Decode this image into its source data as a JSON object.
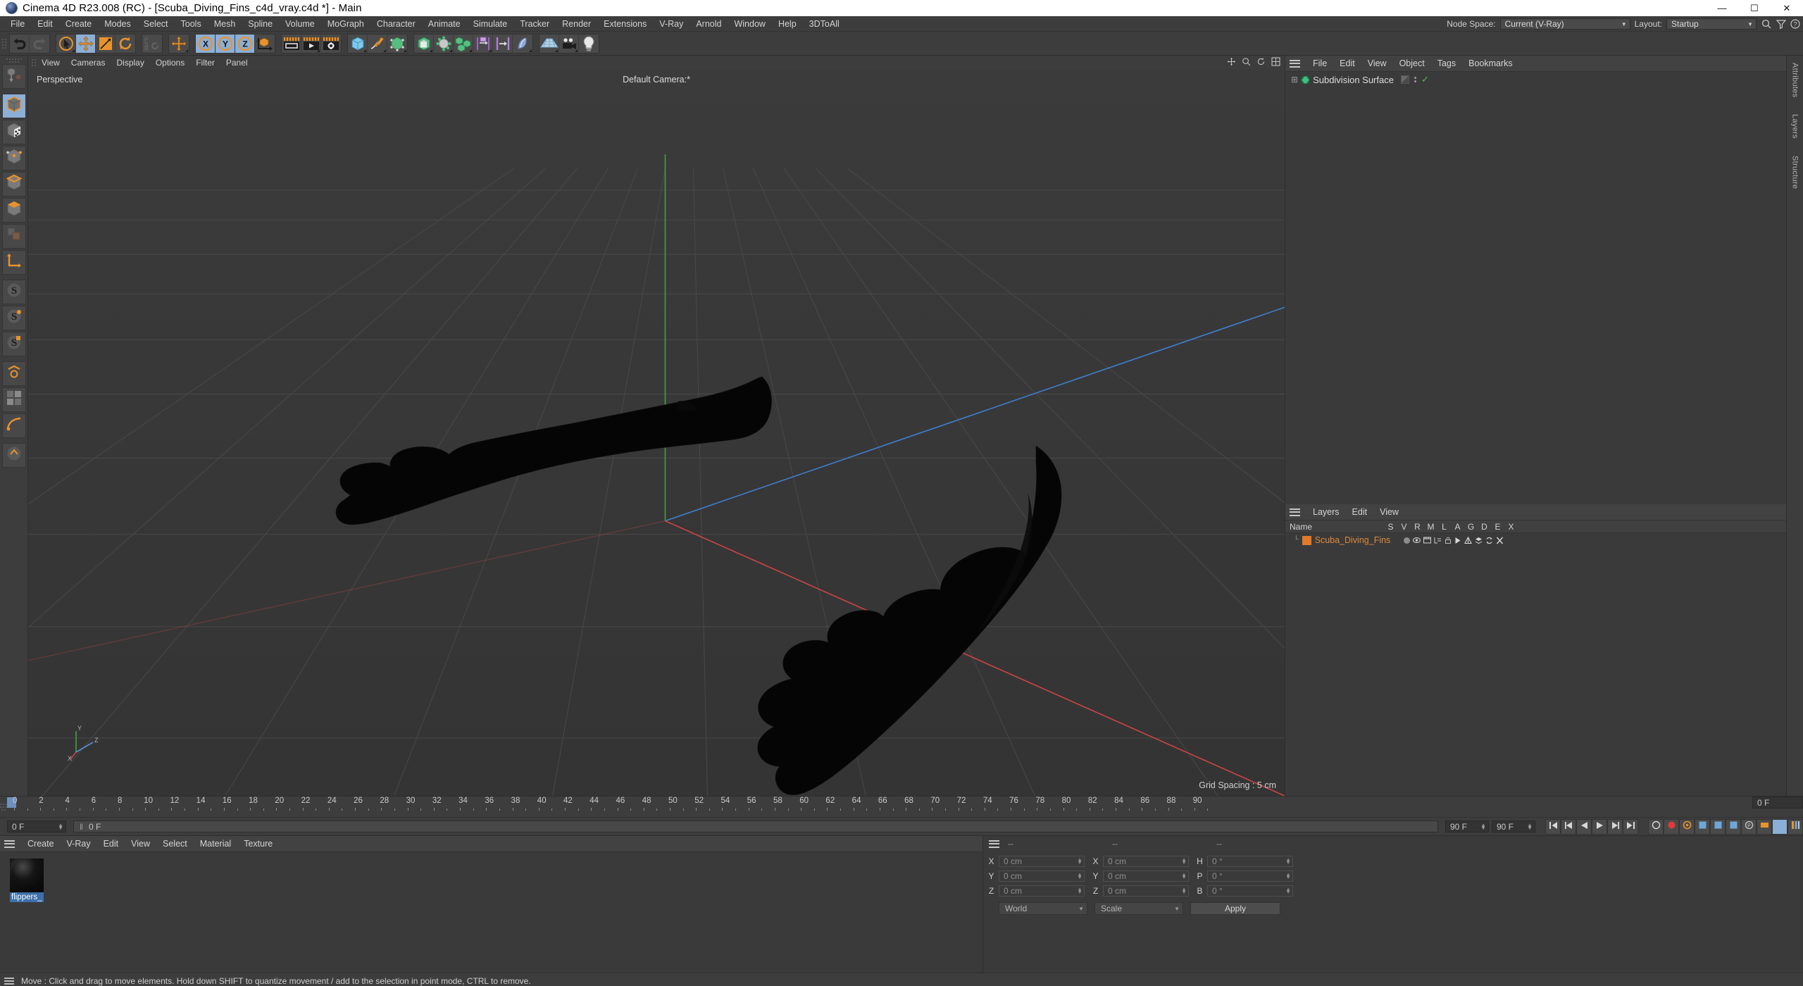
{
  "window": {
    "title": "Cinema 4D R23.008 (RC) - [Scuba_Diving_Fins_c4d_vray.c4d *] - Main",
    "minimize": "—",
    "maximize": "☐",
    "close": "✕"
  },
  "menubar": {
    "items": [
      "File",
      "Edit",
      "Create",
      "Modes",
      "Select",
      "Tools",
      "Mesh",
      "Spline",
      "Volume",
      "MoGraph",
      "Character",
      "Animate",
      "Simulate",
      "Tracker",
      "Render",
      "Extensions",
      "V-Ray",
      "Arnold",
      "Window",
      "Help",
      "3DToAll"
    ],
    "node_space_label": "Node Space:",
    "node_space_value": "Current (V-Ray)",
    "layout_label": "Layout:",
    "layout_value": "Startup"
  },
  "toolbar": {
    "groups": [
      {
        "name": "history",
        "buttons": [
          {
            "id": "undo-button",
            "icon": "undo-icon",
            "active": false,
            "corner": false
          },
          {
            "id": "redo-button",
            "icon": "redo-icon",
            "active": false,
            "corner": false
          }
        ]
      },
      {
        "name": "transform",
        "buttons": [
          {
            "id": "select-tool",
            "icon": "live-selection-icon",
            "active": false,
            "corner": true
          },
          {
            "id": "move-tool",
            "icon": "move-icon",
            "active": true,
            "corner": false
          },
          {
            "id": "scale-tool",
            "icon": "scale-icon",
            "active": false,
            "corner": false
          },
          {
            "id": "rotate-tool",
            "icon": "rotate-icon",
            "active": false,
            "corner": false
          }
        ]
      },
      {
        "name": "psr",
        "buttons": [
          {
            "id": "psr-lock",
            "icon": "psr-icon",
            "active": false,
            "corner": false
          }
        ]
      },
      {
        "name": "world-axis",
        "buttons": [
          {
            "id": "world-coordinate-toggle",
            "icon": "move-world-icon",
            "active": false,
            "corner": true
          }
        ]
      },
      {
        "name": "axis-lock",
        "buttons": [
          {
            "id": "lock-x-axis",
            "icon": "x-axis-icon",
            "active": true,
            "corner": false
          },
          {
            "id": "lock-y-axis",
            "icon": "y-axis-icon",
            "active": true,
            "corner": false
          },
          {
            "id": "lock-z-axis",
            "icon": "z-axis-icon",
            "active": true,
            "corner": false
          },
          {
            "id": "coordinate-system-toggle",
            "icon": "object-world-axis-icon",
            "active": false,
            "corner": false
          }
        ]
      },
      {
        "name": "render",
        "buttons": [
          {
            "id": "render-view-button",
            "icon": "render-view-icon",
            "active": false,
            "corner": false
          },
          {
            "id": "render-to-picture-viewer-button",
            "icon": "render-picture-viewer-icon",
            "active": false,
            "corner": true
          },
          {
            "id": "render-settings-button",
            "icon": "render-settings-icon",
            "active": false,
            "corner": false
          }
        ]
      },
      {
        "name": "create",
        "buttons": [
          {
            "id": "add-cube-button",
            "icon": "cube-icon",
            "active": false,
            "corner": true
          },
          {
            "id": "add-spline-button",
            "icon": "pen-spline-icon",
            "active": false,
            "corner": true
          },
          {
            "id": "add-nurbs-button",
            "icon": "generator-nurbs-icon",
            "active": false,
            "corner": true
          }
        ]
      },
      {
        "name": "deform",
        "buttons": [
          {
            "id": "add-array-button",
            "icon": "array-icon",
            "active": false,
            "corner": true
          },
          {
            "id": "add-bend-button",
            "icon": "bend-deformer-icon",
            "active": false,
            "corner": true
          },
          {
            "id": "add-scene-button",
            "icon": "scene-nodes-icon",
            "active": false,
            "corner": true
          },
          {
            "id": "add-mograph-button",
            "icon": "mograph-cloner-icon",
            "active": false,
            "corner": true
          },
          {
            "id": "add-field-button",
            "icon": "field-icon",
            "active": false,
            "corner": false
          },
          {
            "id": "add-modifier-button",
            "icon": "deformer-icon",
            "active": false,
            "corner": true
          }
        ]
      },
      {
        "name": "scene",
        "buttons": [
          {
            "id": "add-floor-button",
            "icon": "floor-icon",
            "active": false,
            "corner": true
          },
          {
            "id": "add-camera-button",
            "icon": "camera-icon",
            "active": false,
            "corner": true
          },
          {
            "id": "add-light-button",
            "icon": "light-bulb-icon",
            "active": false,
            "corner": false
          }
        ]
      }
    ]
  },
  "leftbar": {
    "buttons": [
      {
        "id": "model-mode",
        "icon": "model-mode-icon",
        "active": false
      },
      {
        "id": "object-mode",
        "icon": "object-mode-icon",
        "active": true
      },
      {
        "id": "texture-mode",
        "icon": "texture-mode-icon",
        "active": false
      },
      {
        "id": "points-mode",
        "icon": "points-mode-icon",
        "active": false
      },
      {
        "id": "edges-mode",
        "icon": "edges-mode-icon",
        "active": false
      },
      {
        "id": "polygons-mode",
        "icon": "polygons-mode-icon",
        "active": false
      },
      {
        "id": "uv-mode",
        "icon": "uv-mode-icon",
        "active": false
      },
      {
        "id": "axis-modify-mode",
        "icon": "axis-modify-icon",
        "active": false
      },
      {
        "id": "enable-snap",
        "icon": "snap-s-icon",
        "active": false
      },
      {
        "id": "snap-settings",
        "icon": "snap-s2-icon",
        "active": false
      },
      {
        "id": "workplane-snap",
        "icon": "snap-s3-icon",
        "active": false
      },
      {
        "id": "viewport-solo",
        "icon": "solo-icon",
        "active": false
      },
      {
        "id": "texture-tile",
        "icon": "tile-icon",
        "active": false
      },
      {
        "id": "deformer-toggle",
        "icon": "deform-toggle-icon",
        "active": false
      },
      {
        "id": "axis-lock-tool",
        "icon": "axis-lock-icon",
        "active": false
      }
    ]
  },
  "viewport": {
    "menu": [
      "View",
      "Cameras",
      "Display",
      "Options",
      "Filter",
      "Panel"
    ],
    "label": "Perspective",
    "camera": "Default Camera:*",
    "grid_spacing": "Grid Spacing : 5 cm",
    "axis_labels": {
      "x": "X",
      "y": "Y",
      "z": "Z"
    }
  },
  "object_manager": {
    "menu": [
      "File",
      "Edit",
      "View",
      "Object",
      "Tags",
      "Bookmarks"
    ],
    "items": [
      {
        "name": "Subdivision Surface",
        "expander": "⊞",
        "enabled": true
      }
    ]
  },
  "layers": {
    "menu": [
      "Layers",
      "Edit",
      "View"
    ],
    "columns": [
      "Name",
      "S",
      "V",
      "R",
      "M",
      "L",
      "A",
      "G",
      "D",
      "E",
      "X"
    ],
    "rows": [
      {
        "name": "Scuba_Diving_Fins",
        "color": "#e07b29"
      }
    ]
  },
  "right_tabs": [
    "Attributes",
    "Layers",
    "Structure"
  ],
  "timeline": {
    "ticks": [
      "0",
      "2",
      "4",
      "6",
      "8",
      "10",
      "12",
      "14",
      "16",
      "18",
      "20",
      "22",
      "24",
      "26",
      "28",
      "30",
      "32",
      "34",
      "36",
      "38",
      "40",
      "42",
      "44",
      "46",
      "48",
      "50",
      "52",
      "54",
      "56",
      "58",
      "60",
      "62",
      "64",
      "66",
      "68",
      "70",
      "72",
      "74",
      "76",
      "78",
      "80",
      "82",
      "84",
      "86",
      "88",
      "90"
    ],
    "end_frame": "0 F",
    "current_frame": "0 F",
    "scrub_value": "0 F",
    "range_start": "90 F",
    "range_end": "90 F"
  },
  "material_manager": {
    "menu": [
      "Create",
      "V-Ray",
      "Edit",
      "View",
      "Select",
      "Material",
      "Texture"
    ],
    "materials": [
      {
        "name": "flippers_",
        "selected": true
      }
    ]
  },
  "coordinates": {
    "header_dashes": [
      "--",
      "--",
      "--"
    ],
    "position": {
      "label_x": "X",
      "label_y": "Y",
      "label_z": "Z",
      "x": "0 cm",
      "y": "0 cm",
      "z": "0 cm"
    },
    "size": {
      "label_x": "X",
      "label_y": "Y",
      "label_z": "Z",
      "x": "0 cm",
      "y": "0 cm",
      "z": "0 cm"
    },
    "rotation": {
      "label_h": "H",
      "label_p": "P",
      "label_b": "B",
      "h": "0 °",
      "p": "0 °",
      "b": "0 °"
    },
    "world_select": "World",
    "scale_select": "Scale",
    "apply_button": "Apply"
  },
  "status": {
    "message": "Move : Click and drag to move elements. Hold down SHIFT to quantize movement / add to the selection in point mode, CTRL to remove."
  },
  "colors": {
    "accent_orange": "#e8922e",
    "active_blue": "#8bafd6",
    "panel_bg": "#3a3a3a",
    "toolbar_bg": "#3d3d3d",
    "viewport_bg": "#373737",
    "layer_orange": "#e07b29"
  }
}
